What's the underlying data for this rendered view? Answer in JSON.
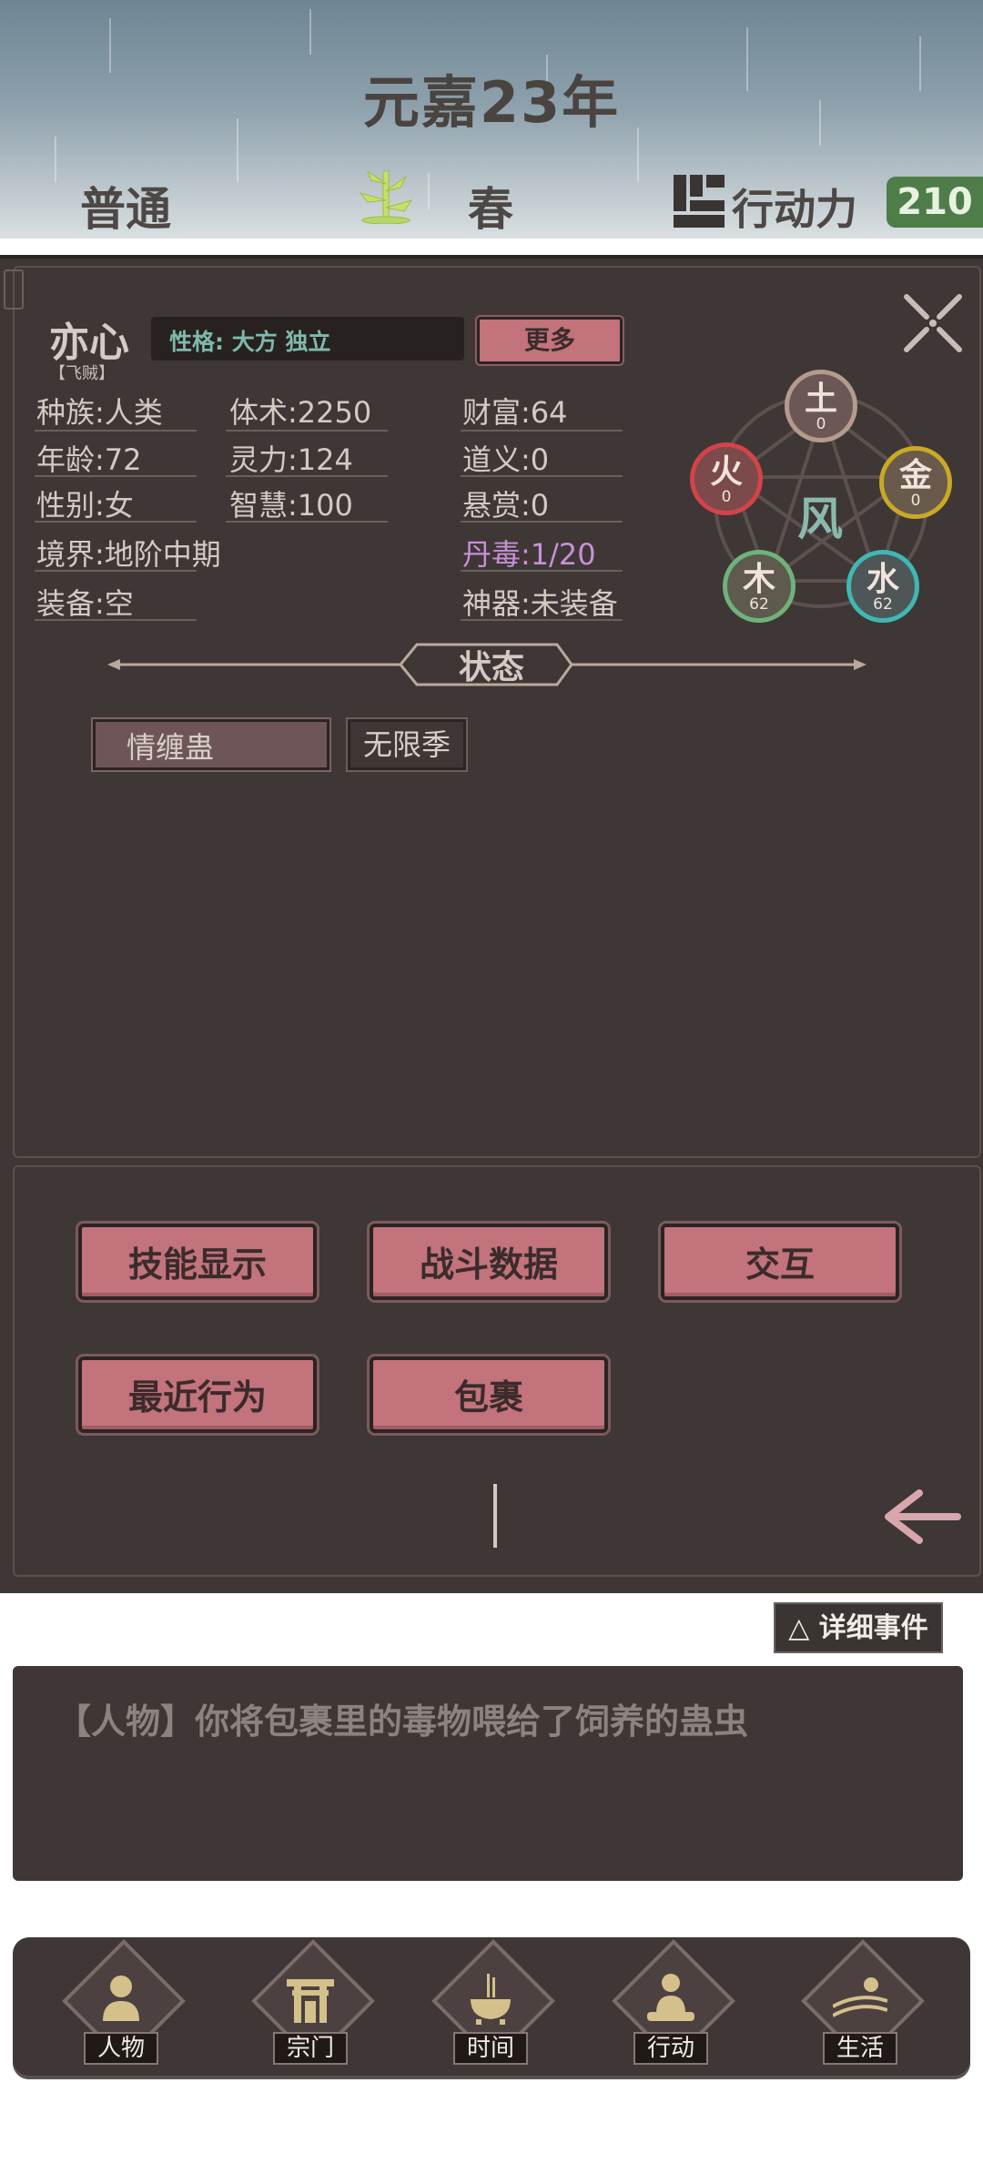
{
  "header": {
    "year": "元嘉23年",
    "difficulty": "普通",
    "season": "春",
    "action_points_label": "行动力",
    "action_points_value": "210"
  },
  "character": {
    "name": "亦心",
    "title": "【飞贼】",
    "personality": "性格: 大方 独立",
    "more_label": "更多",
    "stats": {
      "race": "种族:人类",
      "age": "年龄:72",
      "gender": "性别:女",
      "realm": "境界:地阶中期",
      "equipment": "装备:空",
      "physique": "体术:2250",
      "spirit": "灵力:124",
      "wisdom": "智慧:100",
      "wealth": "财富:64",
      "morality": "道义:0",
      "bounty": "悬赏:0",
      "pill_poison": "丹毒:1/20",
      "artifact": "神器:未装备"
    },
    "elements": {
      "center": "风",
      "earth": {
        "char": "土",
        "value": "0"
      },
      "fire": {
        "char": "火",
        "value": "0"
      },
      "metal": {
        "char": "金",
        "value": "0"
      },
      "wood": {
        "char": "木",
        "value": "62"
      },
      "water": {
        "char": "水",
        "value": "62"
      }
    },
    "status_title": "状态",
    "status_tags": [
      "情缠蛊",
      "无限季"
    ]
  },
  "actions": {
    "skills": "技能显示",
    "battle_data": "战斗数据",
    "interact": "交互",
    "recent": "最近行为",
    "bag": "包裹"
  },
  "events": {
    "detail_button": "△ 详细事件",
    "log": "【人物】你将包裹里的毒物喂给了饲养的蛊虫"
  },
  "nav": {
    "character": "人物",
    "sect": "宗门",
    "time": "时间",
    "action": "行动",
    "life": "生活"
  },
  "colors": {
    "panel_bg": "#3e3736",
    "button_pink": "#c2737b",
    "action_points_green": "#4e7d4a",
    "poison_purple": "#c790d8",
    "fire_red": "#d3434a",
    "earth_tan": "#b59a8e",
    "metal_gold": "#c9a925",
    "wood_green": "#6fb27a",
    "water_teal": "#3fb8b3"
  }
}
